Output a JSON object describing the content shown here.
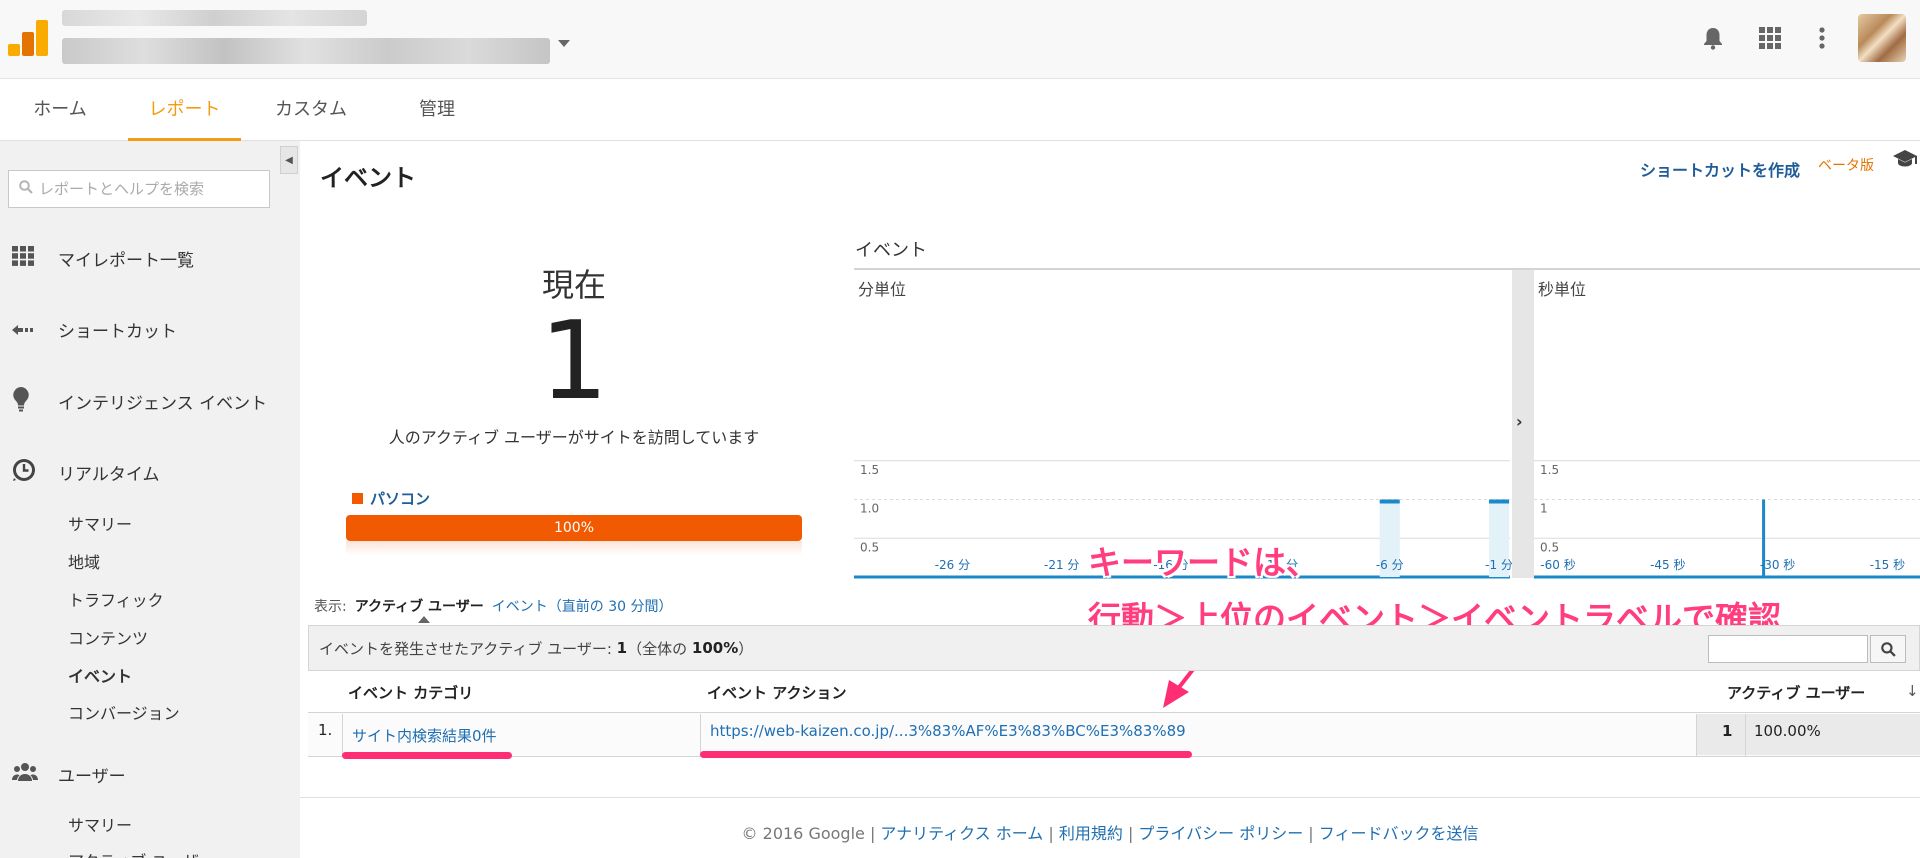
{
  "header": {
    "icons": [
      "bell-icon",
      "apps-grid-icon",
      "more-vert-icon"
    ]
  },
  "nav": {
    "tabs": [
      {
        "label": "ホーム"
      },
      {
        "label": "レポート"
      },
      {
        "label": "カスタム"
      },
      {
        "label": "管理"
      }
    ],
    "active": "レポート"
  },
  "sidebar": {
    "search_placeholder": "レポートとヘルプを検索",
    "items": [
      {
        "label": "マイレポート一覧",
        "icon": "dashboard-grid-icon"
      },
      {
        "label": "ショートカット",
        "icon": "shortcut-arrow-icon"
      },
      {
        "label": "インテリジェンス イベント",
        "icon": "lightbulb-icon"
      },
      {
        "label": "リアルタイム",
        "icon": "clock-icon"
      }
    ],
    "realtime_sub": [
      "サマリー",
      "地域",
      "トラフィック",
      "コンテンツ",
      "イベント",
      "コンバージョン"
    ],
    "active_sub": "イベント",
    "users": {
      "label": "ユーザー",
      "icon": "users-icon"
    },
    "users_sub": [
      "サマリー",
      "アクティブ ユーザー"
    ]
  },
  "main": {
    "title": "イベント",
    "shortcut_label": "ショートカットを作成",
    "beta_label": "ベータ版",
    "now_label": "現在",
    "now_value": "1",
    "now_desc": "人のアクティブ ユーザーがサイトを訪問しています",
    "device_label": "パソコン",
    "device_percent": "100%",
    "display_label": "表示:",
    "display_current": "アクティブ ユーザー",
    "display_alt": "イベント（直前の 30 分間）",
    "table_summary_prefix": "イベントを発生させたアクティブ ユーザー:",
    "table_summary_count": "1",
    "table_summary_mid": "（全体の",
    "table_summary_pct": "100%",
    "table_summary_end": "）",
    "table": {
      "columns": [
        "イベント カテゴリ",
        "イベント アクション",
        "アクティブ ユーザー"
      ],
      "sort_icon": "arrow-down-icon",
      "rows": [
        {
          "index": "1.",
          "category": "サイト内検索結果0件",
          "action": "https://web-kaizen.co.jp/...3%83%AF%E3%83%BC%E3%83%89",
          "users": "1",
          "percent": "100.00%"
        }
      ]
    }
  },
  "annotation": {
    "line1": "キーワードは、",
    "line2": "行動＞上位のイベント＞イベントラベルで確認",
    "color": "#ff3d7f"
  },
  "chart_data": [
    {
      "type": "bar",
      "title": "イベント",
      "subtitle": "分単位",
      "x_tick_labels": [
        "-26 分",
        "-21 分",
        "-16 分",
        "-11 分",
        "-6 分",
        "-1 分"
      ],
      "y_tick_labels": [
        "0.5",
        "1.0",
        "1.5"
      ],
      "ylim": [
        0,
        2
      ],
      "x": [
        "-30 分",
        "-29 分",
        "-28 分",
        "-27 分",
        "-26 分",
        "-25 分",
        "-24 分",
        "-23 分",
        "-22 分",
        "-21 分",
        "-20 分",
        "-19 分",
        "-18 分",
        "-17 分",
        "-16 分",
        "-15 分",
        "-14 分",
        "-13 分",
        "-12 分",
        "-11 分",
        "-10 分",
        "-9 分",
        "-8 分",
        "-7 分",
        "-6 分",
        "-5 分",
        "-4 分",
        "-3 分",
        "-2 分",
        "-1 分"
      ],
      "values": [
        0,
        0,
        0,
        0,
        0,
        0,
        0,
        0,
        0,
        0,
        0,
        0,
        0,
        0,
        0,
        0,
        0,
        0,
        0,
        0,
        0,
        0,
        0,
        0,
        1,
        0,
        0,
        0,
        0,
        1
      ],
      "grid": true,
      "color": "#1a88c9"
    },
    {
      "type": "bar",
      "subtitle": "秒単位",
      "x_tick_labels": [
        "-60 秒",
        "-45 秒",
        "-30 秒",
        "-15 秒"
      ],
      "y_tick_labels": [
        "0.5",
        "1",
        "1.5"
      ],
      "ylim": [
        0,
        2
      ],
      "x": [
        -60,
        -30
      ],
      "values": [
        0,
        1
      ],
      "grid": true,
      "color": "#1a88c9"
    }
  ],
  "footer": {
    "copyright": "© 2016 Google",
    "links": [
      "アナリティクス ホーム",
      "利用規約",
      "プライバシー ポリシー",
      "フィードバックを送信"
    ]
  }
}
